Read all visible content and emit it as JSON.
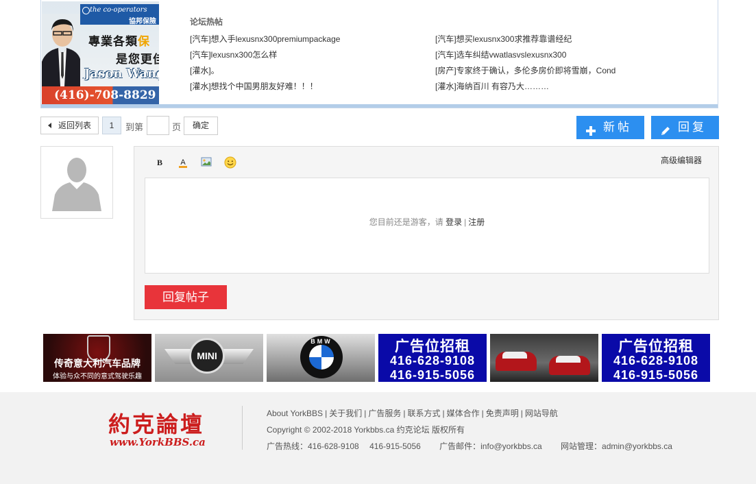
{
  "ad_banner": {
    "brand": "the co-operators",
    "brand_cn": "協邦保險",
    "slogan_line1": "專業各類",
    "slogan_line1_hl": "保",
    "slogan_line2": "是您更佳",
    "agent_name": "Jason Wang",
    "phone": "(416)-708-8829"
  },
  "hot_topics": {
    "title": "论坛热帖",
    "items": [
      "[汽车]想入手lexusnx300premiumpackage",
      "[汽车]想买lexusnx300求推荐靠谱经纪",
      "[汽车]lexusnx300怎么样",
      "[汽车]选车纠结vwatlasvslexusnx300",
      "[灌水]。",
      "[房产]专家终于确认，多伦多房价即将雪崩，Cond",
      "[灌水]想找个中国男朋友好难！！！",
      "[灌水]海纳百川 有容乃大………"
    ]
  },
  "toolbar": {
    "back_label": "返回列表",
    "current_page": "1",
    "goto_prefix": "到第",
    "goto_value": "",
    "goto_suffix": "页",
    "ok_label": "确定",
    "new_post_label": "新帖",
    "reply_label": "回复"
  },
  "editor": {
    "bold_label": "B",
    "color_label": "A",
    "advanced_label": "高级编辑器",
    "guest_prefix": "您目前还是游客，请",
    "login_label": "登录",
    "separator": "|",
    "register_label": "注册",
    "submit_label": "回复帖子"
  },
  "ads": {
    "alfa_title": "传奇意大利汽车品牌",
    "alfa_sub": "体验与众不同的意式驾驶乐趣",
    "mini_text": "MINI",
    "bmw_text": "BMW",
    "rent_title": "广告位招租",
    "rent_phone1": "416-628-9108",
    "rent_phone2": "416-915-5056"
  },
  "footer": {
    "logo_cn": "約克論壇",
    "logo_en": "www.YorkBBS.ca",
    "links": [
      "About YorkBBS",
      "关于我们",
      "广告服务",
      "联系方式",
      "媒体合作",
      "免责声明",
      "网站导航"
    ],
    "copyright": "Copyright © 2002-2018 Yorkbbs.ca 约克论坛 版权所有",
    "hotline": "广告热线：416-628-9108　 416-915-5056",
    "ad_email": "广告邮件：info@yorkbbs.ca",
    "admin_email": "网站管理：admin@yorkbbs.ca"
  },
  "colors": {
    "accent_blue": "#2c8ff0",
    "submit_red": "#e8343a",
    "rent_blue": "#0a0aa8",
    "logo_red": "#cc1e1e"
  }
}
